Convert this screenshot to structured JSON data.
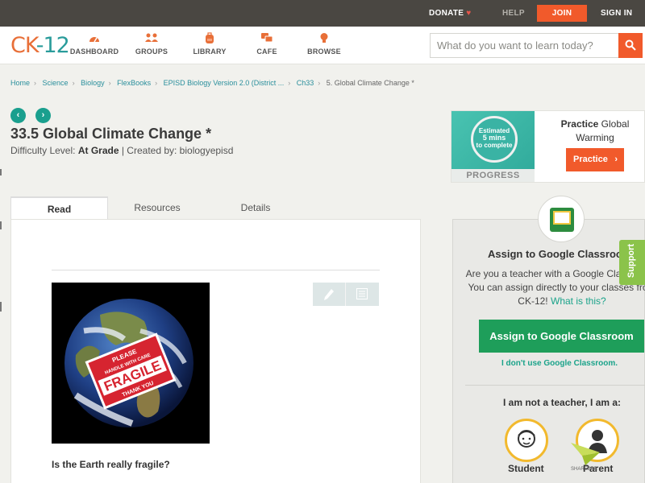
{
  "topbar": {
    "donate": "DONATE",
    "help": "HELP",
    "join": "JOIN",
    "signin": "SIGN IN"
  },
  "logo": {
    "ck": "CK",
    "num": "-12"
  },
  "nav": {
    "dashboard": "DASHBOARD",
    "groups": "GROUPS",
    "library": "LIBRARY",
    "cafe": "CAFE",
    "browse": "BROWSE"
  },
  "search": {
    "placeholder": "What do you want to learn today?"
  },
  "breadcrumb": [
    "Home",
    "Science",
    "Biology",
    "FlexBooks",
    "EPISD Biology Version 2.0 (District ...",
    "Ch33",
    "5. Global Climate Change *"
  ],
  "page": {
    "title": "33.5 Global Climate Change *",
    "difficulty_label": "Difficulty Level:",
    "difficulty_value": "At Grade",
    "created_by": "| Created by: biologyepisd"
  },
  "tabs": {
    "read": "Read",
    "resources": "Resources",
    "details": "Details"
  },
  "image": {
    "sticker_line1": "PLEASE",
    "sticker_line2": "HANDLE WITH CARE",
    "sticker_main": "FRAGILE",
    "sticker_line3": "THANK YOU"
  },
  "caption": "Is the Earth really fragile?",
  "practice": {
    "estimated": "Estimated",
    "mins": "5 mins",
    "to_complete": "to complete",
    "progress": "PROGRESS",
    "title_bold": "Practice",
    "title_rest": "Global Warming",
    "button": "Practice"
  },
  "assign": {
    "title": "Assign to Google Classroom",
    "body": "Are you a teacher with a Google Classroom? You can assign directly to your classes from CK-12!",
    "what_is_this": "What is this?",
    "button": "Assign to Google Classroom",
    "no_gc": "I don't use Google Classroom.",
    "not_teacher": "I am not a teacher, I am a:",
    "student": "Student",
    "parent": "Parent"
  },
  "support": "Support",
  "sharebar": "SHAREBAR",
  "colors": {
    "brand_orange": "#f15a2b",
    "brand_teal": "#1a9f8e",
    "google_green": "#1e9e5a",
    "topbar_bg": "#4a4742"
  }
}
